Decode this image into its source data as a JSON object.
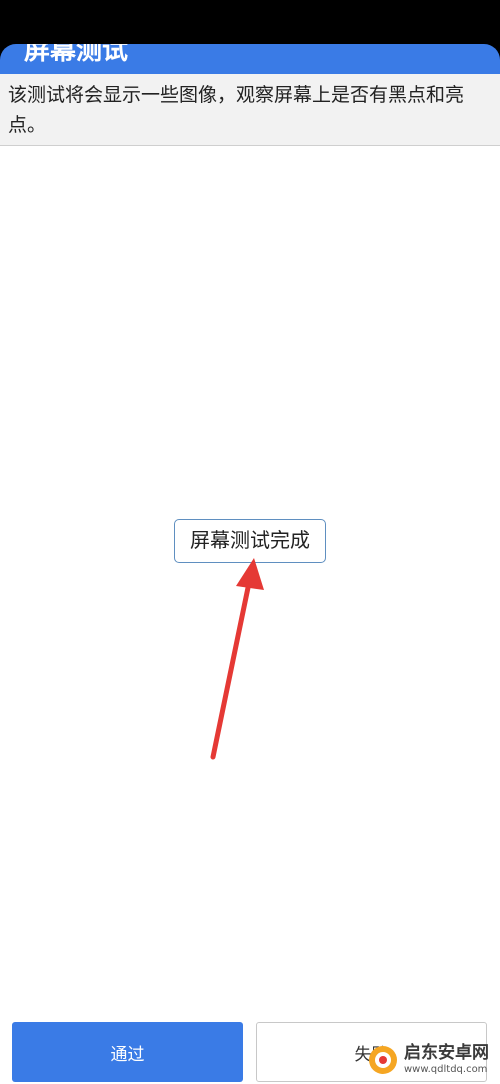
{
  "header": {
    "title": "屏幕测试"
  },
  "description": {
    "text": "该测试将会显示一些图像，观察屏幕上是否有黑点和亮点。"
  },
  "test_area": {
    "done_label": "屏幕测试完成"
  },
  "buttons": {
    "pass_label": "通过",
    "fail_label": "失败"
  },
  "watermark": {
    "site_name": "启东安卓网",
    "url": "www.qdltdq.com"
  },
  "colors": {
    "accent": "#3a7be6",
    "arrow": "#e53935"
  }
}
